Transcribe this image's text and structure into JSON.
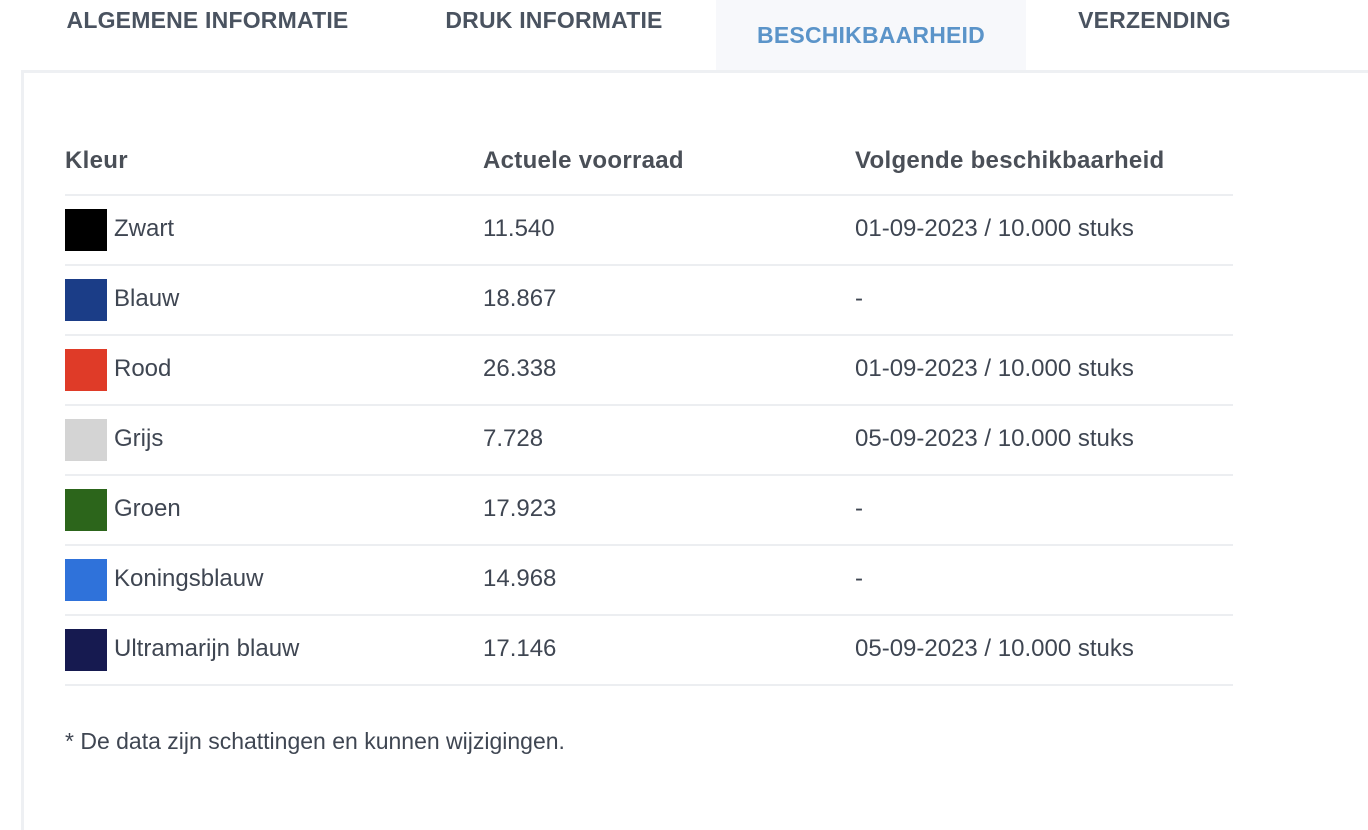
{
  "tabs": [
    {
      "label": "ALGEMENE INFORMATIE",
      "active": false
    },
    {
      "label": "DRUK INFORMATIE",
      "active": false
    },
    {
      "label": "BESCHIKBAARHEID",
      "active": true
    },
    {
      "label": "VERZENDING",
      "active": false
    }
  ],
  "table": {
    "headers": {
      "color": "Kleur",
      "stock": "Actuele voorraad",
      "next": "Volgende beschikbaarheid"
    },
    "rows": [
      {
        "color_name": "Zwart",
        "swatch": "#000000",
        "stock": "11.540",
        "next": "01-09-2023 / 10.000 stuks"
      },
      {
        "color_name": "Blauw",
        "swatch": "#1b3d87",
        "stock": "18.867",
        "next": "-"
      },
      {
        "color_name": "Rood",
        "swatch": "#df3b28",
        "stock": "26.338",
        "next": "01-09-2023 / 10.000 stuks"
      },
      {
        "color_name": "Grijs",
        "swatch": "#d4d4d4",
        "stock": "7.728",
        "next": "05-09-2023 / 10.000 stuks"
      },
      {
        "color_name": "Groen",
        "swatch": "#2c651b",
        "stock": "17.923",
        "next": "-"
      },
      {
        "color_name": "Koningsblauw",
        "swatch": "#2f72da",
        "stock": "14.968",
        "next": "-"
      },
      {
        "color_name": "Ultramarijn blauw",
        "swatch": "#161a50",
        "stock": "17.146",
        "next": "05-09-2023 / 10.000 stuks"
      }
    ]
  },
  "footnote": "* De data zijn schattingen en kunnen wijzigingen."
}
